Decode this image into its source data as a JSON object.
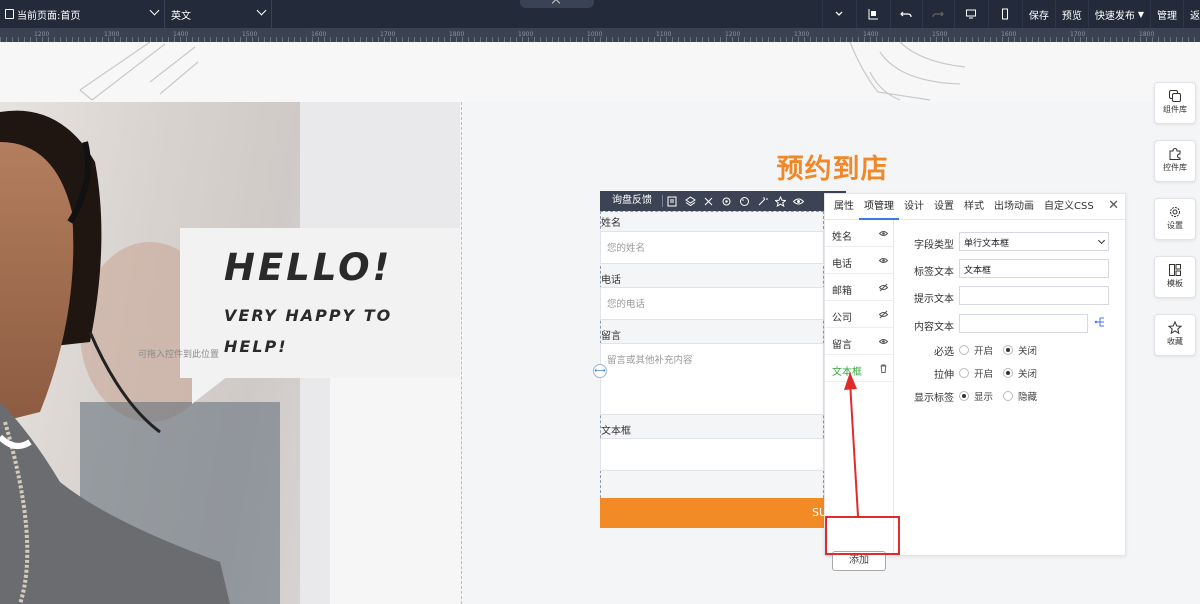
{
  "topbar": {
    "page_select": "当前页面:首页",
    "lang_select": "英文",
    "tools": [
      {
        "name": "collapse-icon",
        "label": ""
      },
      {
        "name": "align-icon",
        "label": ""
      },
      {
        "name": "undo-icon",
        "label": ""
      },
      {
        "name": "redo-icon",
        "label": ""
      },
      {
        "name": "desktop-icon",
        "label": ""
      },
      {
        "name": "mobile-icon",
        "label": ""
      }
    ],
    "save": "保存",
    "preview": "预览",
    "publish": "快速发布",
    "manage": "管理",
    "back": "返"
  },
  "ruler": {
    "ticks": [
      "1200",
      "1300",
      "1400",
      "1500",
      "1600",
      "1700",
      "1800",
      "1900",
      "1000",
      "1100",
      "1200",
      "1300",
      "1400",
      "1500",
      "1600",
      "1700",
      "1800"
    ]
  },
  "canvas": {
    "hello": "HELLO!",
    "happy": "VERY HAPPY TO HELP!",
    "drag_hint": "可拖入控件到此位置",
    "section_title": "预约到店"
  },
  "form": {
    "toolbar_title": "询盘反馈",
    "fields": [
      {
        "label": "姓名",
        "placeholder": "您的姓名"
      },
      {
        "label": "电话",
        "placeholder": "您的电话"
      },
      {
        "label": "留言",
        "placeholder": "留言或其他补充内容"
      },
      {
        "label": "文本框",
        "placeholder": ""
      }
    ],
    "submit": "SU"
  },
  "panel": {
    "tabs": [
      "属性",
      "项管理",
      "设计",
      "设置",
      "样式",
      "出场动画",
      "自定义CSS"
    ],
    "close": "✕",
    "items": [
      "姓名",
      "电话",
      "邮箱",
      "公司",
      "留言",
      "文本框"
    ],
    "add_button": "添加",
    "props": {
      "field_type_label": "字段类型",
      "field_type_value": "单行文本框",
      "label_text_label": "标签文本",
      "label_text_value": "文本框",
      "hint_text_label": "提示文本",
      "content_text_label": "内容文本",
      "required_label": "必选",
      "stretch_label": "拉伸",
      "show_label_label": "显示标签",
      "on": "开启",
      "off": "关闭",
      "show": "显示",
      "hide": "隐藏"
    }
  },
  "dock": [
    "组件库",
    "控件库",
    "设置",
    "模板",
    "收藏"
  ],
  "colors": {
    "accent": "#f28b25",
    "toolbar": "#232b3a",
    "highlight": "#e02b2b",
    "active_item": "#3aa640"
  }
}
